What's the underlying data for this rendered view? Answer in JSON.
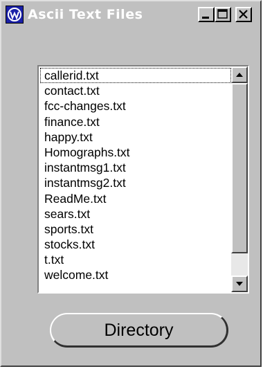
{
  "window": {
    "title": "Ascii Text Files",
    "icon": "app-logo-icon"
  },
  "title_buttons": {
    "minimize": "minimize-icon",
    "maximize": "maximize-icon",
    "close": "close-icon"
  },
  "file_list": {
    "items": [
      "callerid.txt",
      "contact.txt",
      "fcc-changes.txt",
      "finance.txt",
      "happy.txt",
      "Homographs.txt",
      "instantmsg1.txt",
      "instantmsg2.txt",
      "ReadMe.txt",
      "sears.txt",
      "sports.txt",
      "stocks.txt",
      "t.txt",
      "welcome.txt"
    ],
    "focused_index": 0
  },
  "directory_button": {
    "label": "Directory"
  },
  "colors": {
    "face": "#c0c0c0",
    "icon_blue": "#1a20a8"
  }
}
